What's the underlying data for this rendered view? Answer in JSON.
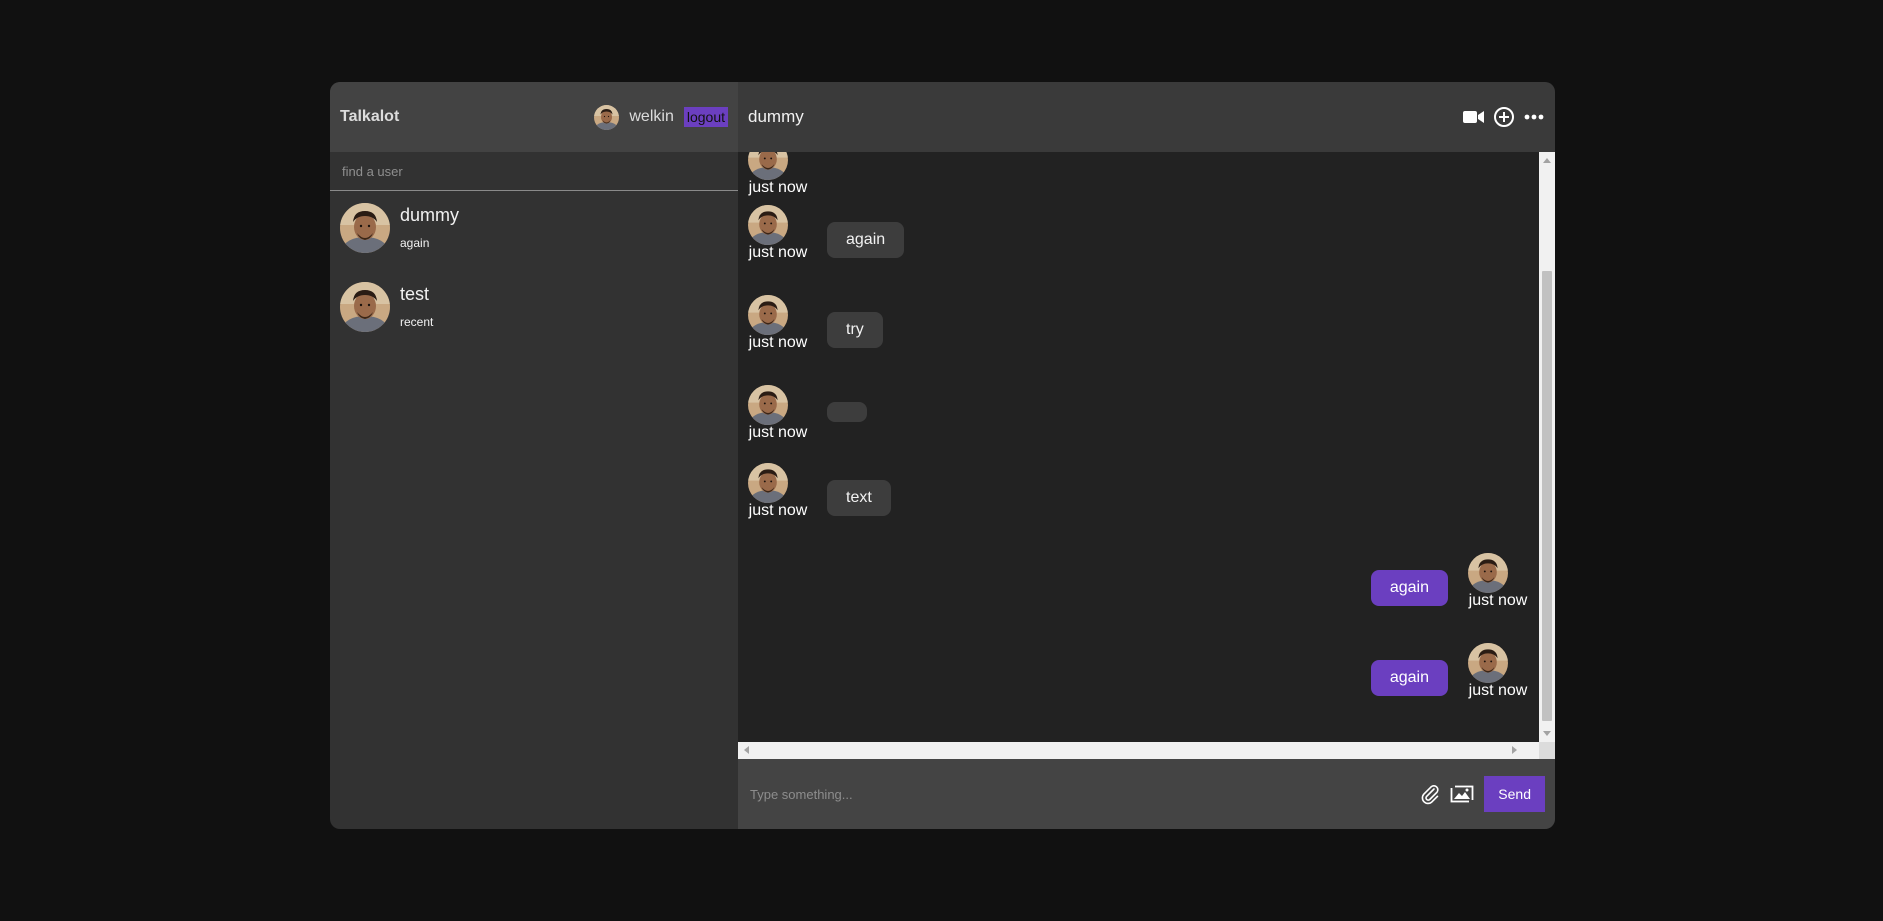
{
  "app": {
    "brand": "Talkalot",
    "current_user": {
      "name": "welkin",
      "avatar_icon": "user-avatar"
    },
    "logout_label": "logout",
    "accent_color": "#6b3fc0"
  },
  "sidebar": {
    "search_placeholder": "find a user",
    "users": [
      {
        "name": "dummy",
        "last_message": "again"
      },
      {
        "name": "test",
        "last_message": "recent"
      }
    ]
  },
  "chat": {
    "title": "dummy",
    "header_icons": [
      "video-camera-icon",
      "add-circle-icon",
      "more-options-icon"
    ],
    "messages": [
      {
        "from": "them",
        "text": "",
        "time": "just now"
      },
      {
        "from": "them",
        "text": "again",
        "time": "just now"
      },
      {
        "from": "them",
        "text": "try",
        "time": "just now"
      },
      {
        "from": "them",
        "text": "",
        "time": "just now"
      },
      {
        "from": "them",
        "text": "text",
        "time": "just now"
      },
      {
        "from": "me",
        "text": "again",
        "time": "just now"
      },
      {
        "from": "me",
        "text": "again",
        "time": "just now"
      }
    ],
    "composer": {
      "placeholder": "Type something...",
      "icons": [
        "attachment-icon",
        "image-icon"
      ],
      "send_label": "Send"
    }
  }
}
